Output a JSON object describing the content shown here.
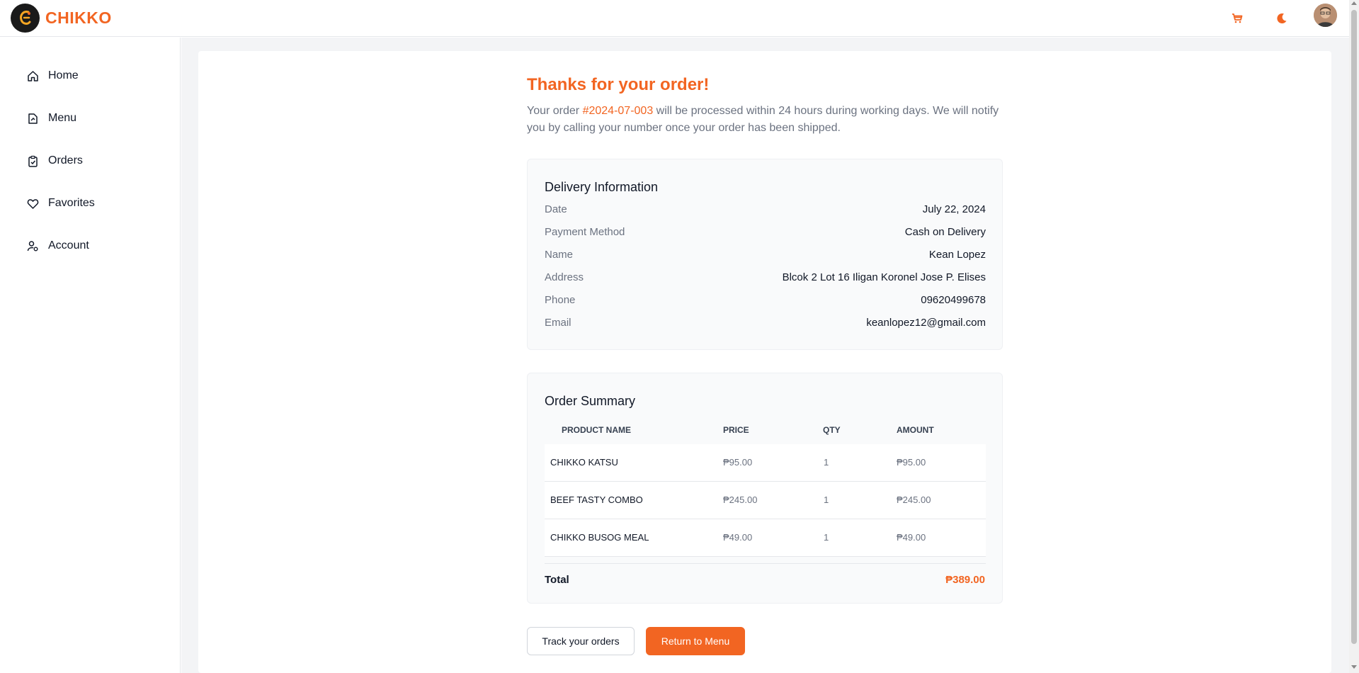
{
  "header": {
    "brand": "CHIKKO",
    "logo_icon": "chicken-logo-icon",
    "cart_icon": "cart-icon",
    "theme_icon": "moon-icon",
    "accent": "#f26522"
  },
  "sidebar": {
    "items": [
      {
        "label": "Home",
        "icon": "home-icon"
      },
      {
        "label": "Menu",
        "icon": "menu-book-icon"
      },
      {
        "label": "Orders",
        "icon": "clipboard-icon"
      },
      {
        "label": "Favorites",
        "icon": "heart-icon"
      },
      {
        "label": "Account",
        "icon": "user-settings-icon"
      }
    ]
  },
  "confirmation": {
    "title": "Thanks for your order!",
    "intro_before": "Your order ",
    "order_number": "#2024-07-003",
    "intro_after": " will be processed within 24 hours during working days. We will notify you by calling your number once your order has been shipped."
  },
  "delivery": {
    "title": "Delivery Information",
    "rows": [
      {
        "label": "Date",
        "value": "July 22, 2024"
      },
      {
        "label": "Payment Method",
        "value": "Cash on Delivery"
      },
      {
        "label": "Name",
        "value": "Kean Lopez"
      },
      {
        "label": "Address",
        "value": "Blcok 2 Lot 16 Iligan Koronel Jose P. Elises"
      },
      {
        "label": "Phone",
        "value": "09620499678"
      },
      {
        "label": "Email",
        "value": "keanlopez12@gmail.com"
      }
    ]
  },
  "summary": {
    "title": "Order Summary",
    "columns": [
      "PRODUCT NAME",
      "PRICE",
      "QTY",
      "AMOUNT"
    ],
    "rows": [
      {
        "name": "CHIKKO KATSU",
        "price": "₱95.00",
        "qty": "1",
        "amount": "₱95.00"
      },
      {
        "name": "BEEF TASTY COMBO",
        "price": "₱245.00",
        "qty": "1",
        "amount": "₱245.00"
      },
      {
        "name": "CHIKKO BUSOG MEAL",
        "price": "₱49.00",
        "qty": "1",
        "amount": "₱49.00"
      }
    ],
    "total_label": "Total",
    "total_value": "₱389.00"
  },
  "actions": {
    "track_label": "Track your orders",
    "return_label": "Return to Menu"
  }
}
